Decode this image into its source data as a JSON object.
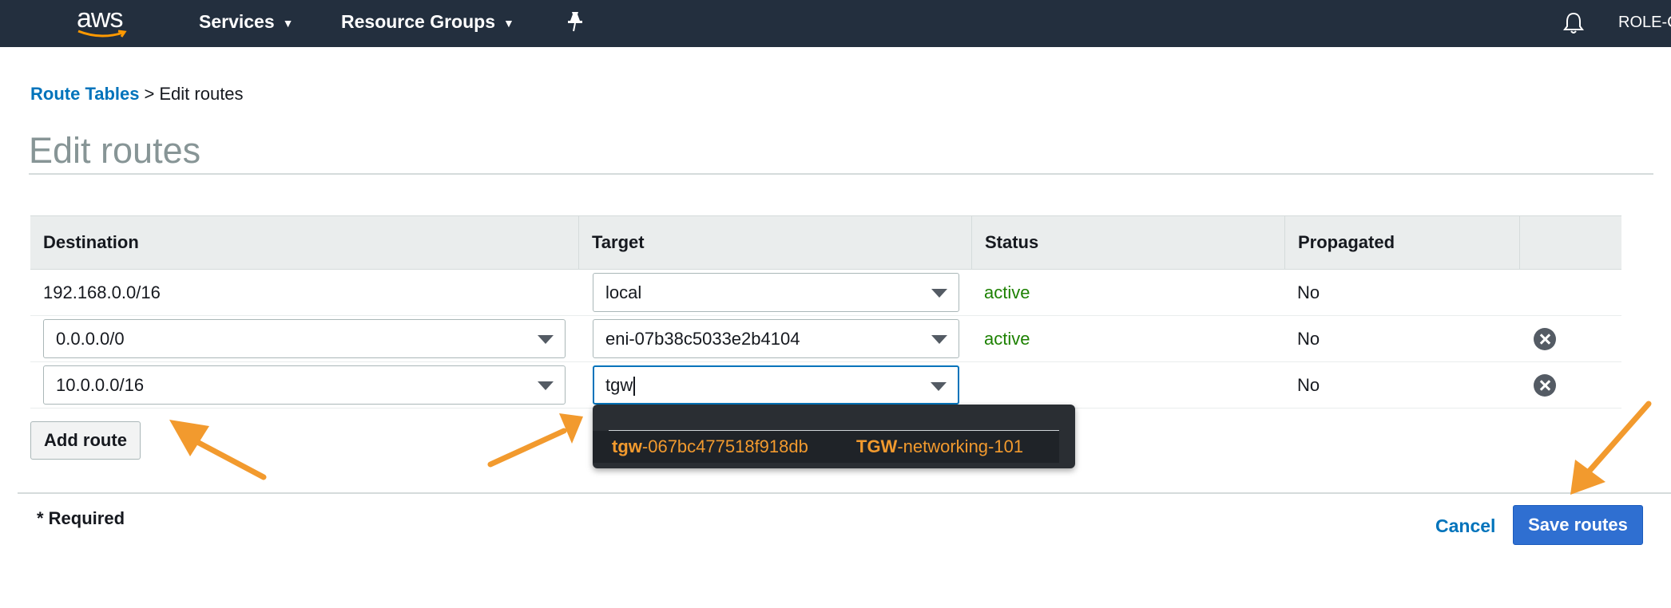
{
  "topbar": {
    "logo_text": "aws",
    "services_label": "Services",
    "resource_groups_label": "Resource Groups",
    "role_text": "ROLE-C",
    "bg_color": "#232f3e"
  },
  "breadcrumb": {
    "parent": "Route Tables",
    "separator": ">",
    "current": "Edit routes"
  },
  "page": {
    "title": "Edit routes"
  },
  "table": {
    "columns": [
      "Destination",
      "Target",
      "Status",
      "Propagated"
    ],
    "rows": [
      {
        "destination": "192.168.0.0/16",
        "target": "local",
        "status": "active",
        "propagated": "No"
      },
      {
        "destination": "0.0.0.0/0",
        "target": "eni-07b38c5033e2b4104",
        "status": "active",
        "propagated": "No"
      },
      {
        "destination": "10.0.0.0/16",
        "target": "tgw",
        "status": "",
        "propagated": "No"
      }
    ]
  },
  "dropdown": {
    "option": {
      "id_match": "tgw",
      "id_rest": "-067bc477518f918db",
      "name_match": "TGW",
      "name_rest": "-networking-101"
    }
  },
  "actions": {
    "add_route": "Add route",
    "required_note": "* Required",
    "cancel": "Cancel",
    "save": "Save routes"
  },
  "colors": {
    "link": "#0073bb",
    "active_status": "#1d8102",
    "primary_button": "#2f6fd1",
    "annotation_arrow": "#f29a2e"
  }
}
